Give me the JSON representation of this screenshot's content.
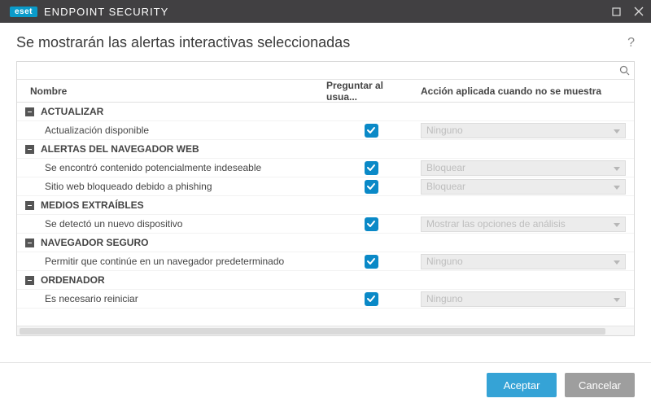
{
  "titlebar": {
    "brand": "eset",
    "product": "ENDPOINT SECURITY"
  },
  "heading": "Se mostrarán las alertas interactivas seleccionadas",
  "help_symbol": "?",
  "columns": {
    "name": "Nombre",
    "ask": "Preguntar al usua...",
    "action": "Acción aplicada cuando no se muestra"
  },
  "groups": [
    {
      "label": "ACTUALIZAR",
      "items": [
        {
          "name": "Actualización disponible",
          "ask": true,
          "action": "Ninguno"
        }
      ]
    },
    {
      "label": "ALERTAS DEL NAVEGADOR WEB",
      "items": [
        {
          "name": "Se encontró contenido potencialmente indeseable",
          "ask": true,
          "action": "Bloquear"
        },
        {
          "name": "Sitio web bloqueado debido a phishing",
          "ask": true,
          "action": "Bloquear"
        }
      ]
    },
    {
      "label": "MEDIOS EXTRAÍBLES",
      "items": [
        {
          "name": "Se detectó un nuevo dispositivo",
          "ask": true,
          "action": "Mostrar las opciones de análisis"
        }
      ]
    },
    {
      "label": "NAVEGADOR SEGURO",
      "items": [
        {
          "name": "Permitir que continúe en un navegador predeterminado",
          "ask": true,
          "action": "Ninguno"
        }
      ]
    },
    {
      "label": "ORDENADOR",
      "items": [
        {
          "name": "Es necesario reiniciar",
          "ask": true,
          "action": "Ninguno"
        }
      ]
    }
  ],
  "buttons": {
    "accept": "Aceptar",
    "cancel": "Cancelar"
  },
  "toggle_glyph": "–"
}
